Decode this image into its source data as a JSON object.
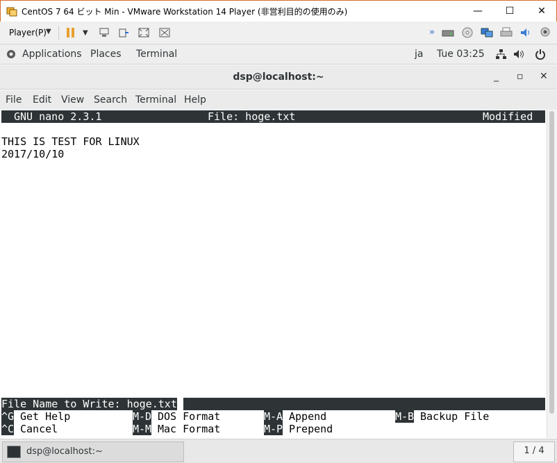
{
  "window": {
    "title": "CentOS 7 64 ビット Min - VMware Workstation 14 Player (非営利目的の使用のみ)",
    "minimize": "—",
    "maximize": "☐",
    "close": "✕"
  },
  "vmware_toolbar": {
    "player_menu": "Player(P)"
  },
  "gnome_topbar": {
    "applications": "Applications",
    "places": "Places",
    "terminal": "Terminal",
    "lang": "ja",
    "clock": "Tue 03:25"
  },
  "terminal_window": {
    "title": "dsp@localhost:~",
    "minimize": "_",
    "maximize": "▫",
    "close": "✕"
  },
  "menu": {
    "file": "File",
    "edit": "Edit",
    "view": "View",
    "search": "Search",
    "terminal": "Terminal",
    "help": "Help"
  },
  "nano": {
    "version": "GNU nano 2.3.1",
    "file": "File: hoge.txt",
    "status": "Modified",
    "lines": [
      "THIS IS TEST FOR LINUX",
      "2017/10/10"
    ],
    "prompt": "File Name to Write: hoge.txt",
    "shortcuts_row1": [
      {
        "key": "^G",
        "label": "Get Help"
      },
      {
        "key": "M-D",
        "label": "DOS Format"
      },
      {
        "key": "M-A",
        "label": "Append"
      },
      {
        "key": "M-B",
        "label": "Backup File"
      }
    ],
    "shortcuts_row2": [
      {
        "key": "^C",
        "label": "Cancel"
      },
      {
        "key": "M-M",
        "label": "Mac Format"
      },
      {
        "key": "M-P",
        "label": "Prepend"
      }
    ]
  },
  "taskbar": {
    "item": "dsp@localhost:~",
    "workspace": "1 / 4"
  }
}
